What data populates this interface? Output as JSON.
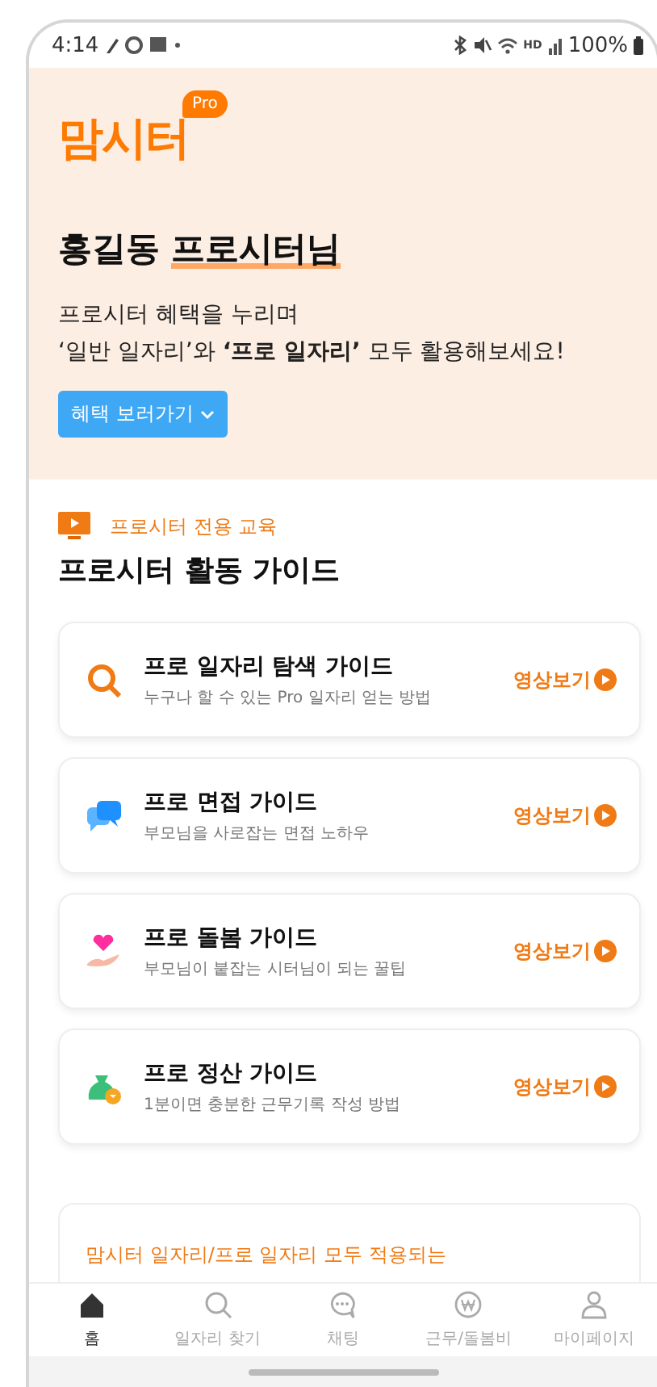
{
  "status_bar": {
    "time": "4:14",
    "hd": "HD",
    "battery": "100%"
  },
  "hero": {
    "logo": "맘시터",
    "logo_badge": "Pro",
    "name": "홍길동",
    "title_highlight": "프로시터님",
    "subtitle": "프로시터 혜택을 누리며\n‘일반 일자리’와 **‘프로 일자리’** 모두 활용해보세요!",
    "button": "혜택 보러가기"
  },
  "section": {
    "label": "프로시터 전용 교육",
    "heading": "프로시터 활동 가이드",
    "guides": [
      {
        "kind": "search",
        "title": "프로 일자리 탐색 가이드",
        "description": "누구나 할 수 있는 Pro 일자리 얻는 방법",
        "action": "영상보기"
      },
      {
        "kind": "chat",
        "title": "프로 면접 가이드",
        "description": "부모님을 사로잡는 면접 노하우",
        "action": "영상보기"
      },
      {
        "kind": "care",
        "title": "프로 돌봄 가이드",
        "description": "부모님이 붙잡는 시터님이 되는 꿀팁",
        "action": "영상보기"
      },
      {
        "kind": "money",
        "title": "프로 정산 가이드",
        "description": "1분이면 충분한 근무기록 작성 방법",
        "action": "영상보기"
      }
    ]
  },
  "next_card": {
    "label": "맘시터 일자리/프로 일자리 모두 적용되는"
  },
  "bottom_nav": [
    {
      "kind": "home",
      "label": "홈",
      "selected": true
    },
    {
      "kind": "search",
      "label": "일자리 찾기",
      "selected": false
    },
    {
      "kind": "chat",
      "label": "채팅",
      "selected": false
    },
    {
      "kind": "won",
      "label": "근무/돌봄비",
      "selected": false
    },
    {
      "kind": "person",
      "label": "마이페이지",
      "selected": false
    }
  ]
}
